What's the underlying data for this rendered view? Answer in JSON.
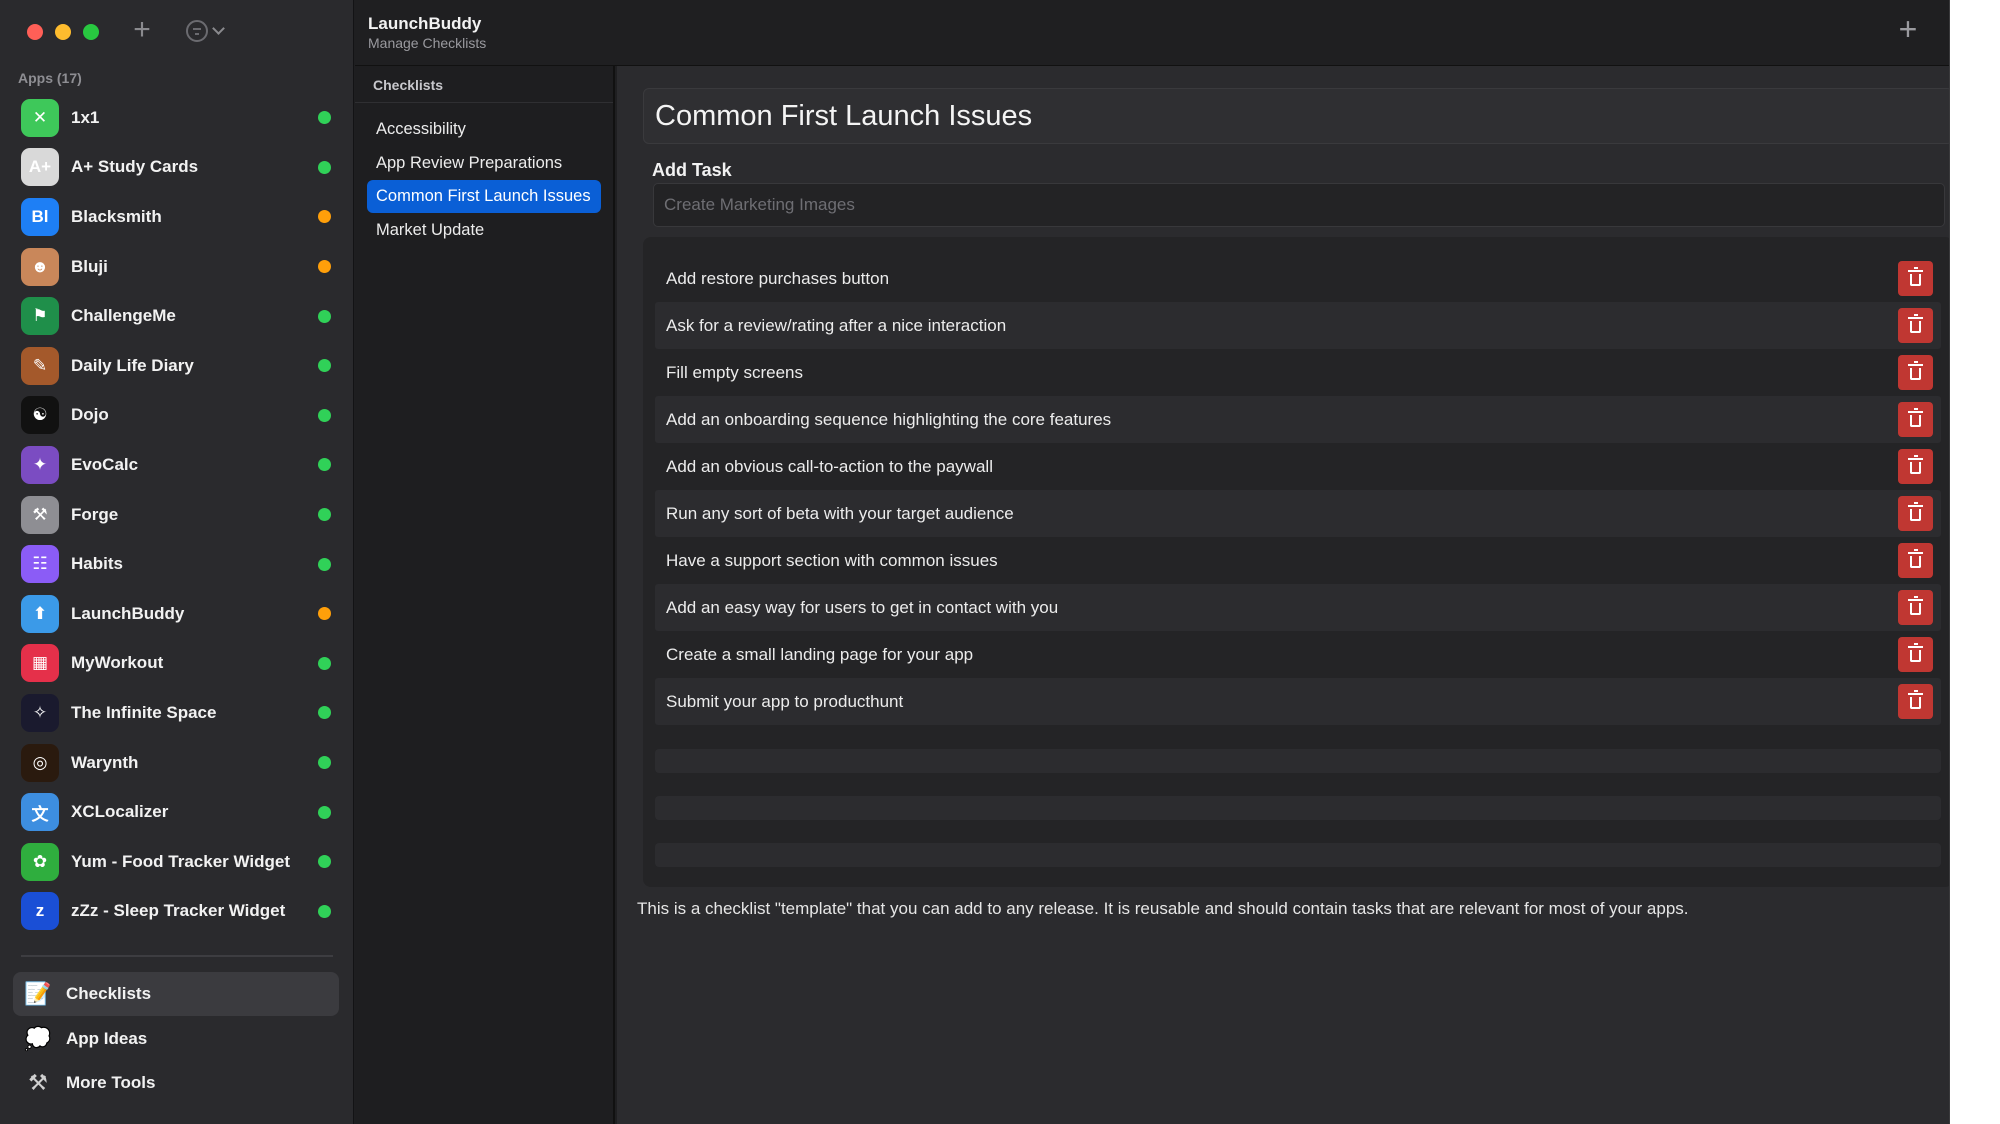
{
  "sidebar": {
    "section_title": "Apps (17)",
    "apps": [
      {
        "name": "1x1",
        "icon": "x-mark-icon",
        "icon_glyph": "✕",
        "icon_bg": "#3ec85a",
        "status_color": "#30d158"
      },
      {
        "name": "A+ Study Cards",
        "icon": "study-cards-icon",
        "icon_glyph": "A+",
        "icon_bg": "#d9d9d9",
        "status_color": "#30d158"
      },
      {
        "name": "Blacksmith",
        "icon": "blacksmith-icon",
        "icon_glyph": "Bl",
        "icon_bg": "#1e7ff5",
        "status_color": "#ff9f0a"
      },
      {
        "name": "Bluji",
        "icon": "bluji-icon",
        "icon_glyph": "☻",
        "icon_bg": "#c9875a",
        "status_color": "#ff9f0a"
      },
      {
        "name": "ChallengeMe",
        "icon": "challengeme-icon",
        "icon_glyph": "⚑",
        "icon_bg": "#1f8f4a",
        "status_color": "#30d158"
      },
      {
        "name": "Daily Life Diary",
        "icon": "diary-icon",
        "icon_glyph": "✎",
        "icon_bg": "#a4592b",
        "status_color": "#30d158"
      },
      {
        "name": "Dojo",
        "icon": "dojo-icon",
        "icon_glyph": "☯",
        "icon_bg": "#111111",
        "status_color": "#30d158"
      },
      {
        "name": "EvoCalc",
        "icon": "evocalc-icon",
        "icon_glyph": "✦",
        "icon_bg": "#7b4cc2",
        "status_color": "#30d158"
      },
      {
        "name": "Forge",
        "icon": "forge-icon",
        "icon_glyph": "⚒",
        "icon_bg": "#8e8e93",
        "status_color": "#30d158"
      },
      {
        "name": "Habits",
        "icon": "habits-icon",
        "icon_glyph": "☷",
        "icon_bg": "#8b5cf6",
        "status_color": "#30d158"
      },
      {
        "name": "LaunchBuddy",
        "icon": "launchbuddy-icon",
        "icon_glyph": "⬆",
        "icon_bg": "#3b9ae8",
        "status_color": "#ff9f0a"
      },
      {
        "name": "MyWorkout",
        "icon": "myworkout-icon",
        "icon_glyph": "▦",
        "icon_bg": "#e5304a",
        "status_color": "#30d158"
      },
      {
        "name": "The Infinite Space",
        "icon": "rocket-icon",
        "icon_glyph": "✧",
        "icon_bg": "#1a1a2e",
        "status_color": "#30d158"
      },
      {
        "name": "Warynth",
        "icon": "warynth-icon",
        "icon_glyph": "◎",
        "icon_bg": "#2a1a0e",
        "status_color": "#30d158"
      },
      {
        "name": "XCLocalizer",
        "icon": "xclocalizer-icon",
        "icon_glyph": "文",
        "icon_bg": "#3d8ee0",
        "status_color": "#30d158"
      },
      {
        "name": "Yum - Food Tracker Widget",
        "icon": "yum-icon",
        "icon_glyph": "✿",
        "icon_bg": "#2fae3e",
        "status_color": "#30d158"
      },
      {
        "name": "zZz - Sleep Tracker Widget",
        "icon": "sleep-icon",
        "icon_glyph": "z",
        "icon_bg": "#1a4fd6",
        "status_color": "#30d158"
      }
    ],
    "bottom_nav": [
      {
        "label": "Checklists",
        "icon": "notepad-icon",
        "icon_glyph": "📝",
        "selected": true
      },
      {
        "label": "App Ideas",
        "icon": "thought-bubble-icon",
        "icon_glyph": "💭",
        "selected": false
      },
      {
        "label": "More Tools",
        "icon": "tools-icon",
        "icon_glyph": "⚒",
        "selected": false
      }
    ]
  },
  "toolbar": {
    "title": "LaunchBuddy",
    "subtitle": "Manage Checklists",
    "add_glyph": "+"
  },
  "checklists": {
    "header": "Checklists",
    "items": [
      {
        "label": "Accessibility",
        "selected": false
      },
      {
        "label": "App Review Preparations",
        "selected": false
      },
      {
        "label": "Common First Launch Issues",
        "selected": true
      },
      {
        "label": "Market Update",
        "selected": false
      }
    ]
  },
  "detail": {
    "title": "Common First Launch Issues",
    "add_task_label": "Add Task",
    "add_task_placeholder": "Create Marketing Images",
    "tasks": [
      "Add restore purchases button",
      "Ask for a review/rating after a nice interaction",
      "Fill empty screens",
      "Add an onboarding sequence highlighting the core features",
      "Add an obvious call-to-action to the paywall",
      "Run any sort of beta with your target audience",
      "Have a support section with common issues",
      "Add an easy way for users to get in contact with you",
      "Create a small landing page for your app",
      "Submit your app to producthunt"
    ],
    "info_text": "This is a checklist \"template\" that you can add to any release. It is reusable and should contain tasks that are relevant for most of your apps."
  },
  "colors": {
    "accent": "#0a5fd6",
    "delete": "#c03732",
    "status_green": "#30d158",
    "status_orange": "#ff9f0a"
  }
}
